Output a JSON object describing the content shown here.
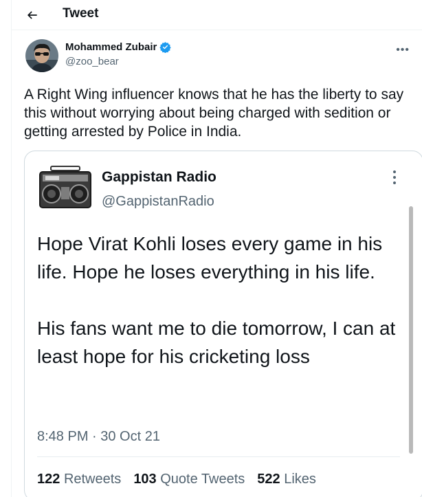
{
  "header": {
    "back_icon": "arrow-left-icon",
    "title": "Tweet"
  },
  "tweet": {
    "author_name": "Mohammed Zubair",
    "author_handle": "@zoo_bear",
    "verified_icon": "verified-badge-icon",
    "more_icon": "more-horizontal-icon",
    "text": "A Right Wing influencer knows that he has the liberty to say this without worrying about being charged with sedition or getting arrested by Police in India."
  },
  "quote": {
    "author_name": "Gappistan Radio",
    "author_handle": "@GappistanRadio",
    "avatar_icon": "boombox-radio-icon",
    "more_icon": "more-vertical-icon",
    "paragraph1": "Hope Virat Kohli loses every game in his life. Hope he loses everything in his life.",
    "paragraph2": "His fans want me to die tomorrow, I can at least hope for his cricketing loss",
    "timestamp": "8:48 PM · 30 Oct 21",
    "stats": {
      "retweets_count": "122",
      "retweets_label": "Retweets",
      "quotes_count": "103",
      "quotes_label": "Quote Tweets",
      "likes_count": "522",
      "likes_label": "Likes"
    }
  },
  "colors": {
    "verified_blue": "#1d9bf0",
    "secondary_text": "#536471",
    "border": "#cfd9de"
  }
}
